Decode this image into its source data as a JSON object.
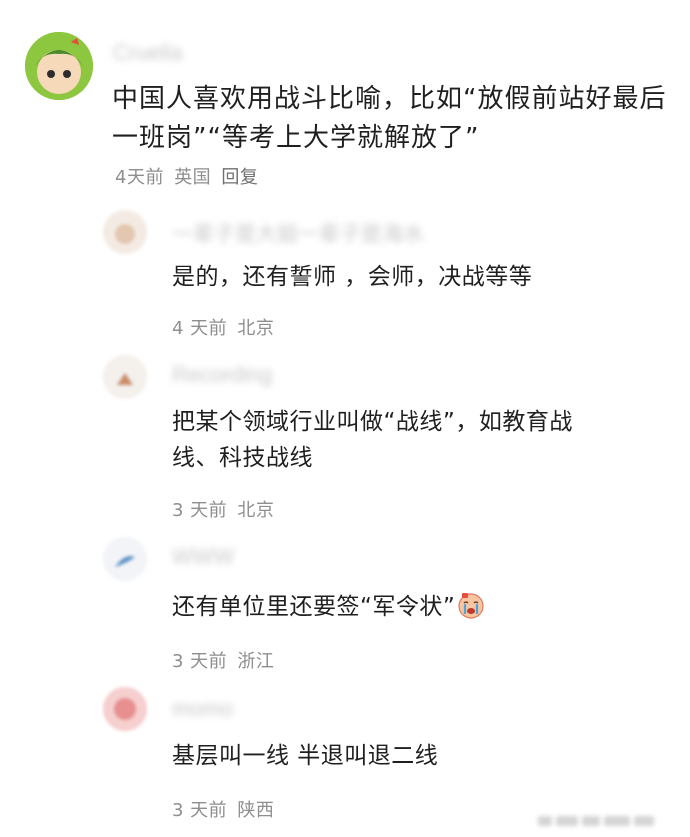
{
  "comments": [
    {
      "author": "Cruella",
      "content": "中国人喜欢用战斗比喻，比如“放假前站好最后一班岗”“等考上大学就解放了”",
      "time": "4天前",
      "location": "英国",
      "reply_label": "回复"
    }
  ],
  "replies": [
    {
      "author": "一辈子是大姐一辈子是海水",
      "content": "是的，还有誓师 ，会师，决战等等",
      "time": "4 天前",
      "location": "北京"
    },
    {
      "author": "Recording",
      "content": "把某个领域行业叫做“战线”，如教育战线、科技战线",
      "time": "3 天前",
      "location": "北京"
    },
    {
      "author": "WWW",
      "content": "还有单位里还要签“军令状”",
      "emoji": "crying-face-emoji",
      "time": "3 天前",
      "location": "浙江"
    },
    {
      "author": "momo",
      "content": "基层叫一线 半退叫退二线",
      "time": "3 天前",
      "location": "陕西"
    }
  ],
  "colors": {
    "text": "#1f1f1f",
    "meta": "#8e8e8e",
    "blurred_name": "#c9c9c9",
    "background": "#ffffff"
  }
}
